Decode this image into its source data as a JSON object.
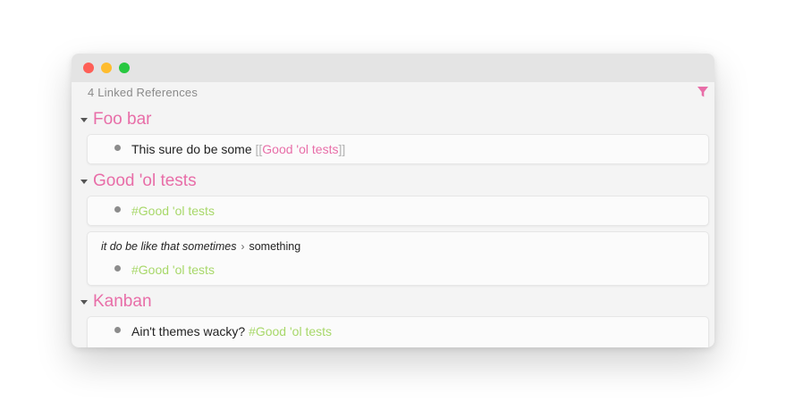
{
  "references_header": "4 Linked References",
  "groups": [
    {
      "title": "Foo bar",
      "blocks": [
        {
          "prefix": "This sure do be some ",
          "bracket_open": "[[",
          "link": "Good 'ol tests",
          "bracket_close": "]]"
        }
      ]
    },
    {
      "title": "Good 'ol tests",
      "blocks": [
        {
          "tag": "#Good 'ol tests"
        },
        {
          "breadcrumb_parent": "it do be like that sometimes",
          "breadcrumb_sep": "›",
          "breadcrumb_child": "something",
          "tag": "#Good 'ol tests"
        }
      ]
    },
    {
      "title": "Kanban",
      "blocks": [
        {
          "prefix": "Ain't themes wacky? ",
          "tag": "#Good 'ol tests"
        }
      ]
    }
  ],
  "colors": {
    "accent": "#e86ea8",
    "tag": "#a8d86a",
    "muted": "#8a8a8a"
  },
  "icons": {
    "filter": "filter-icon"
  }
}
